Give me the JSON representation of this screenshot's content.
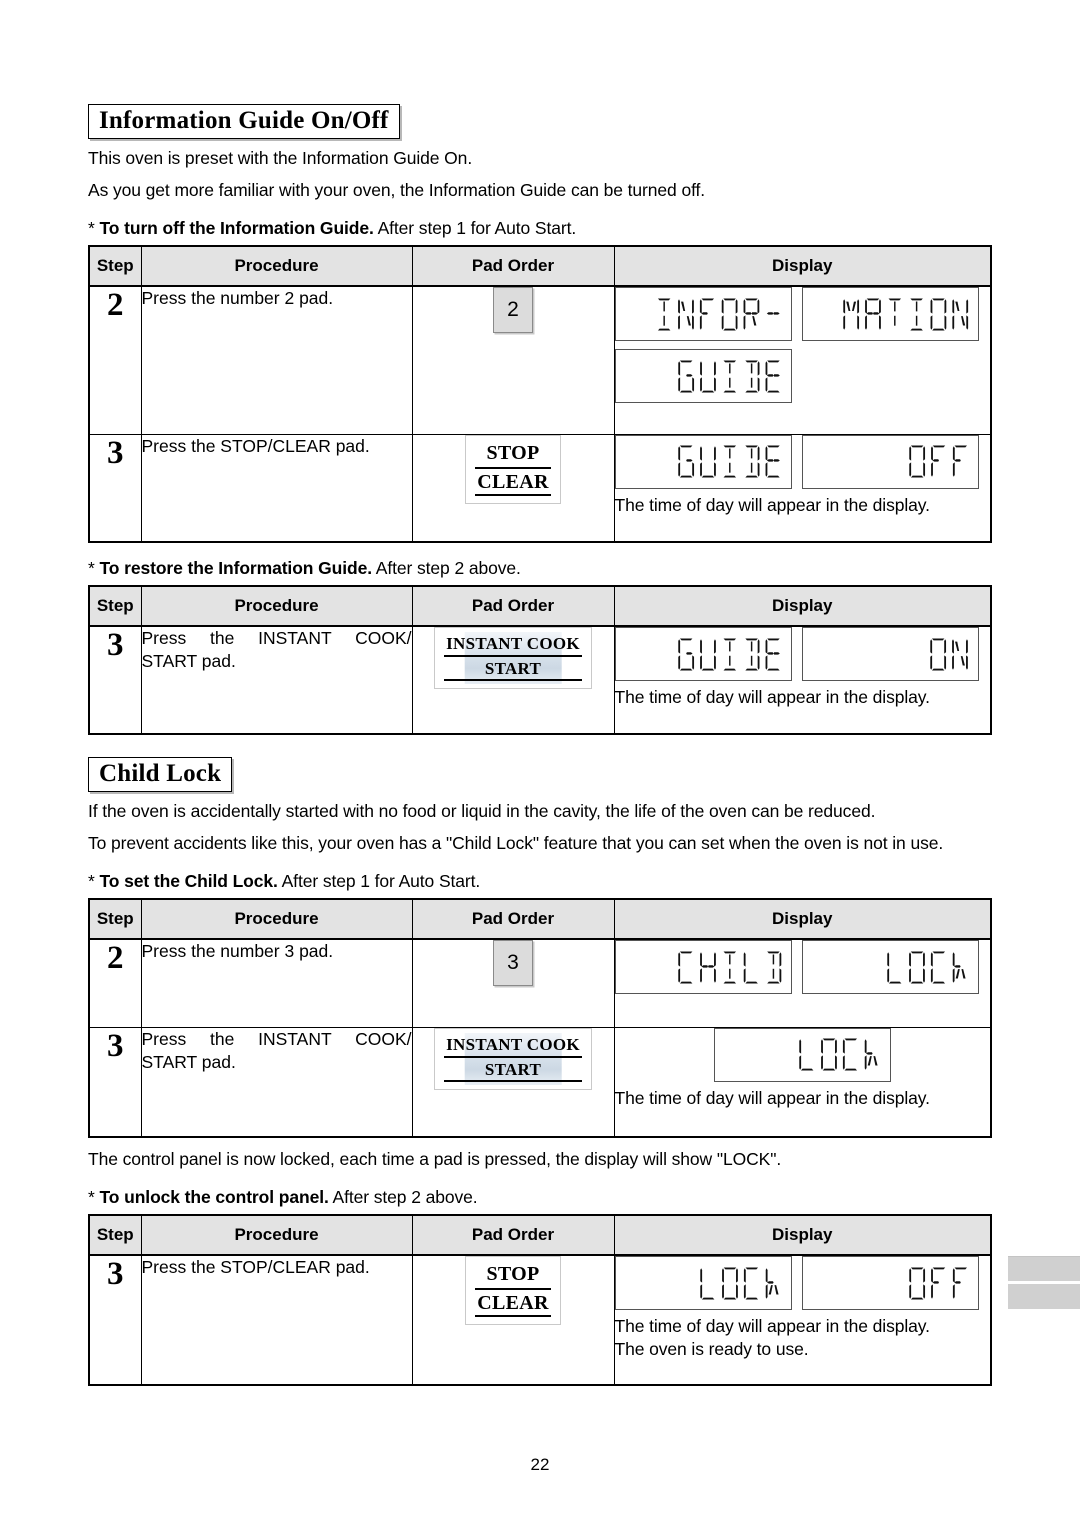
{
  "page": {
    "number": "22"
  },
  "section1": {
    "heading": "Information Guide On/Off",
    "paragraphs": [
      "This oven is preset with the Information Guide On.",
      "As you get more familiar with your oven, the Information Guide can be turned off."
    ],
    "subheads": [
      {
        "star": "*",
        "bold": "To turn off the Information Guide.",
        "rest": " After step 1 for Auto Start."
      },
      {
        "star": "*",
        "bold": "To restore the Information Guide.",
        "rest": " After step 2 above."
      }
    ]
  },
  "section2": {
    "heading": "Child Lock",
    "paragraphs": [
      "If the oven is accidentally started with no food or liquid in the cavity, the life of the oven can be reduced.",
      "To prevent accidents like this, your oven has a \"Child Lock\" feature that you can set when the oven is not in use."
    ],
    "subheads": [
      {
        "star": "*",
        "bold": "To set the Child Lock.",
        "rest": " After step 1 for Auto Start."
      },
      {
        "star": "*",
        "bold": "To unlock the control panel.",
        "rest": " After step 2 above."
      }
    ],
    "note_between": "The control panel is now locked, each time a pad is pressed, the display will show \"LOCK\"."
  },
  "table_headers": {
    "step": "Step",
    "procedure": "Procedure",
    "pad_order": "Pad Order",
    "display": "Display"
  },
  "common": {
    "time_note": "The time of day will appear in the display.",
    "ready_note": "The oven is ready to use."
  },
  "table1": {
    "rows": [
      {
        "step": "2",
        "procedure": "Press the number 2 pad.",
        "pad": {
          "type": "number",
          "label": "2"
        },
        "displays": [
          "INFOR-",
          "MATION",
          "GUIDE"
        ],
        "note": ""
      },
      {
        "step": "3",
        "procedure": "Press the STOP/CLEAR pad.",
        "pad": {
          "type": "two-line",
          "line1": "STOP",
          "line2": "CLEAR"
        },
        "displays": [
          "GUIDE",
          "OFF"
        ],
        "note": "The time of day will appear in the display."
      }
    ]
  },
  "table2": {
    "rows": [
      {
        "step": "3",
        "procedure_line1": "Press the INSTANT COOK/",
        "procedure_line2": "START pad.",
        "pad": {
          "type": "two-line",
          "line1": "INSTANT COOK",
          "line2": "START"
        },
        "displays": [
          "GUIDE",
          "ON"
        ],
        "note": "The time of day will appear in the display."
      }
    ]
  },
  "table3": {
    "rows": [
      {
        "step": "2",
        "procedure": "Press the number 3 pad.",
        "pad": {
          "type": "number",
          "label": "3"
        },
        "displays": [
          "CHILD",
          "LOCK"
        ],
        "note": ""
      },
      {
        "step": "3",
        "procedure_line1": "Press the INSTANT COOK/",
        "procedure_line2": "START pad.",
        "pad": {
          "type": "two-line",
          "line1": "INSTANT COOK",
          "line2": "START"
        },
        "displays": [
          "LOCK"
        ],
        "note": "The time of day will appear in the display."
      }
    ]
  },
  "table4": {
    "rows": [
      {
        "step": "3",
        "procedure": "Press the STOP/CLEAR pad.",
        "pad": {
          "type": "two-line",
          "line1": "STOP",
          "line2": "CLEAR"
        },
        "displays": [
          "LOCK",
          "OFF"
        ],
        "note": "The time of day will appear in the display.",
        "note2": "The oven is ready to use."
      }
    ]
  }
}
